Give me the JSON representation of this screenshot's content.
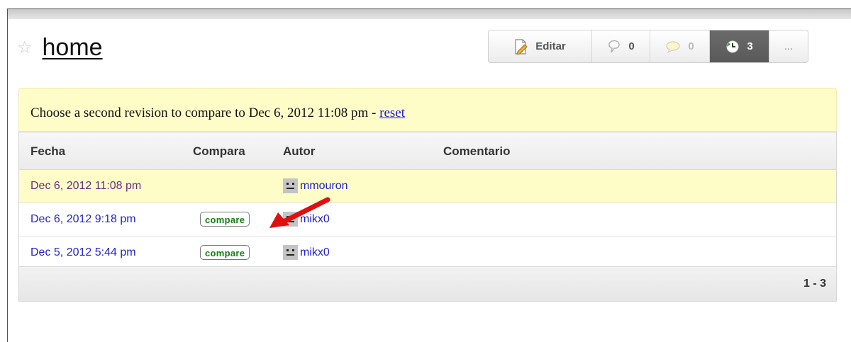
{
  "page": {
    "title": "home"
  },
  "toolbar": {
    "edit_label": "Editar",
    "comments_count": "0",
    "discussion_count": "0",
    "history_count": "3",
    "more_label": "..."
  },
  "notice": {
    "text": "Choose a second revision to compare to Dec 6, 2012 11:08 pm - ",
    "reset_label": "reset"
  },
  "table": {
    "columns": [
      "Fecha",
      "Compara",
      "Autor",
      "Comentario"
    ],
    "rows": [
      {
        "date": "Dec 6, 2012 11:08 pm",
        "compare": "",
        "author": "mmouron",
        "comment": ""
      },
      {
        "date": "Dec 6, 2012 9:18 pm",
        "compare": "compare",
        "author": "mikx0",
        "comment": ""
      },
      {
        "date": "Dec 5, 2012 5:44 pm",
        "compare": "compare",
        "author": "mikx0",
        "comment": ""
      }
    ],
    "pagination": "1 - 3"
  },
  "colors": {
    "notice_bg": "#fefdc8",
    "link": "#2323c8",
    "visited_link": "#6b2c82",
    "compare_green": "#127f12",
    "arrow_red": "#e01010"
  },
  "icons": [
    "star-icon",
    "edit-page-icon",
    "comments-icon",
    "discussion-icon",
    "history-icon",
    "avatar-icon",
    "annotation-arrow"
  ]
}
